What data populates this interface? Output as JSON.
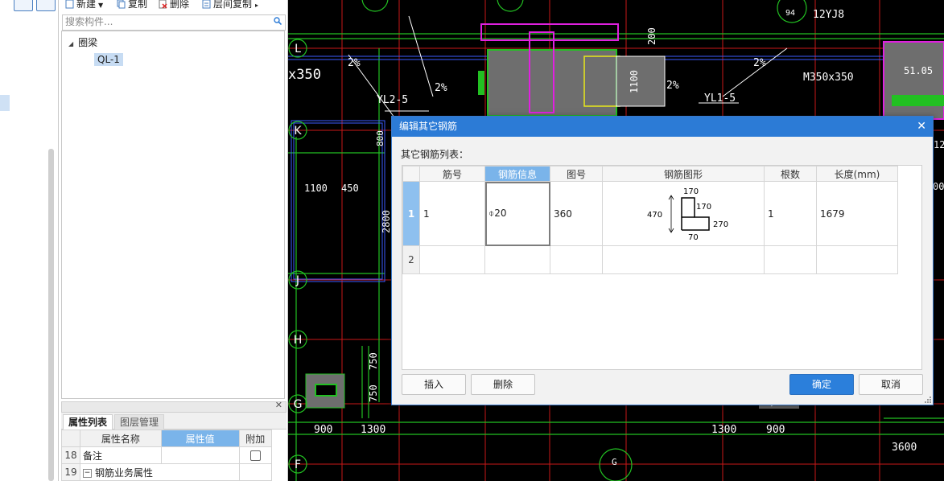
{
  "toolbar": {
    "new_label": "新建",
    "copy_label": "复制",
    "delete_label": "删除",
    "layer_copy_label": "层间复制"
  },
  "search": {
    "placeholder": "搜索构件..."
  },
  "tree": {
    "root_label": "圈梁",
    "child_label": "QL-1"
  },
  "property_panel": {
    "tabs": [
      "属性列表",
      "图层管理"
    ],
    "headers": {
      "name": "属性名称",
      "value": "属性值",
      "extra": "附加"
    },
    "rows": [
      {
        "num": "18",
        "name": "备注",
        "value": ""
      },
      {
        "num": "19",
        "name": "钢筋业务属性",
        "value": ""
      }
    ]
  },
  "cad": {
    "axis_labels": [
      "L",
      "K",
      "J",
      "H",
      "G",
      "F"
    ],
    "texts": {
      "t_x350": "x350",
      "t_2pct_a": "2%",
      "t_2pct_b": "2%",
      "t_2pct_c": "2%",
      "t_2pct_d": "2%",
      "t_yl25": "YL2-5",
      "t_yl15": "YL1-5",
      "t_m350": "M350x350",
      "t_800": "800",
      "t_1100_a": "1100",
      "t_1100_b": "1100",
      "t_450": "450",
      "t_2800": "2800",
      "t_750_a": "750",
      "t_750_b": "750",
      "t_900_a": "900",
      "t_1300_a": "1300",
      "t_1300_b": "1300",
      "t_900_b": "900",
      "t_3600": "3600",
      "t_200": "200",
      "t_94": "94",
      "t_12yj8": "12YJ8",
      "t_5105": "51.05",
      "t_12": "12",
      "t_00": "00",
      "t_g": "G"
    }
  },
  "dialog": {
    "title": "编辑其它钢筋",
    "subtitle": "其它钢筋列表：",
    "columns": [
      "筋号",
      "钢筋信息",
      "图号",
      "钢筋图形",
      "根数",
      "长度(mm)"
    ],
    "rows": [
      {
        "row_num": "1",
        "bar_no": "1",
        "info": "⌽20",
        "shape_no": "360",
        "count": "1",
        "length": "1679",
        "shape_dims": {
          "height": "470",
          "top": "170",
          "mid": "170",
          "right": "270",
          "bottom": "70"
        }
      },
      {
        "row_num": "2",
        "bar_no": "",
        "info": "",
        "shape_no": "",
        "count": "",
        "length": ""
      }
    ],
    "buttons": {
      "insert": "插入",
      "delete": "删除",
      "confirm": "确定",
      "cancel": "取消"
    }
  },
  "colors": {
    "accent": "#2c7bd6",
    "header_highlight": "#7ab4ea",
    "cad_background": "#000000"
  }
}
